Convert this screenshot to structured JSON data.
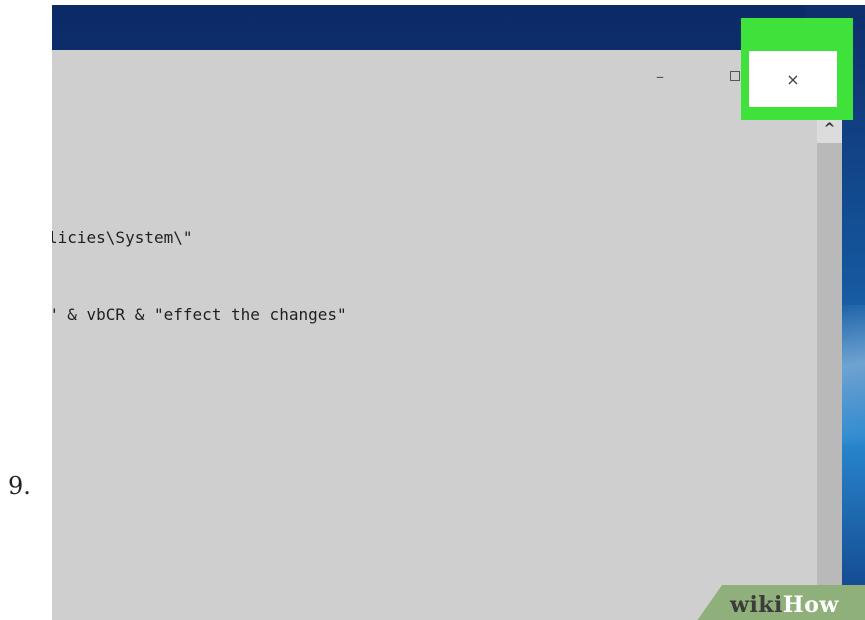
{
  "step": {
    "number": "9."
  },
  "window": {
    "controls": {
      "minimize_glyph": "–",
      "maximize_icon": "maximize-square-icon",
      "close_glyph": "×"
    },
    "highlight_color": "#3ee23a"
  },
  "editor": {
    "lines": [
      "licies\\System\\\"",
      "\" & vbCR & \"effect the changes\""
    ],
    "scroll_up_glyph": "^"
  },
  "watermark": {
    "wiki": "wiki",
    "how": "How"
  }
}
